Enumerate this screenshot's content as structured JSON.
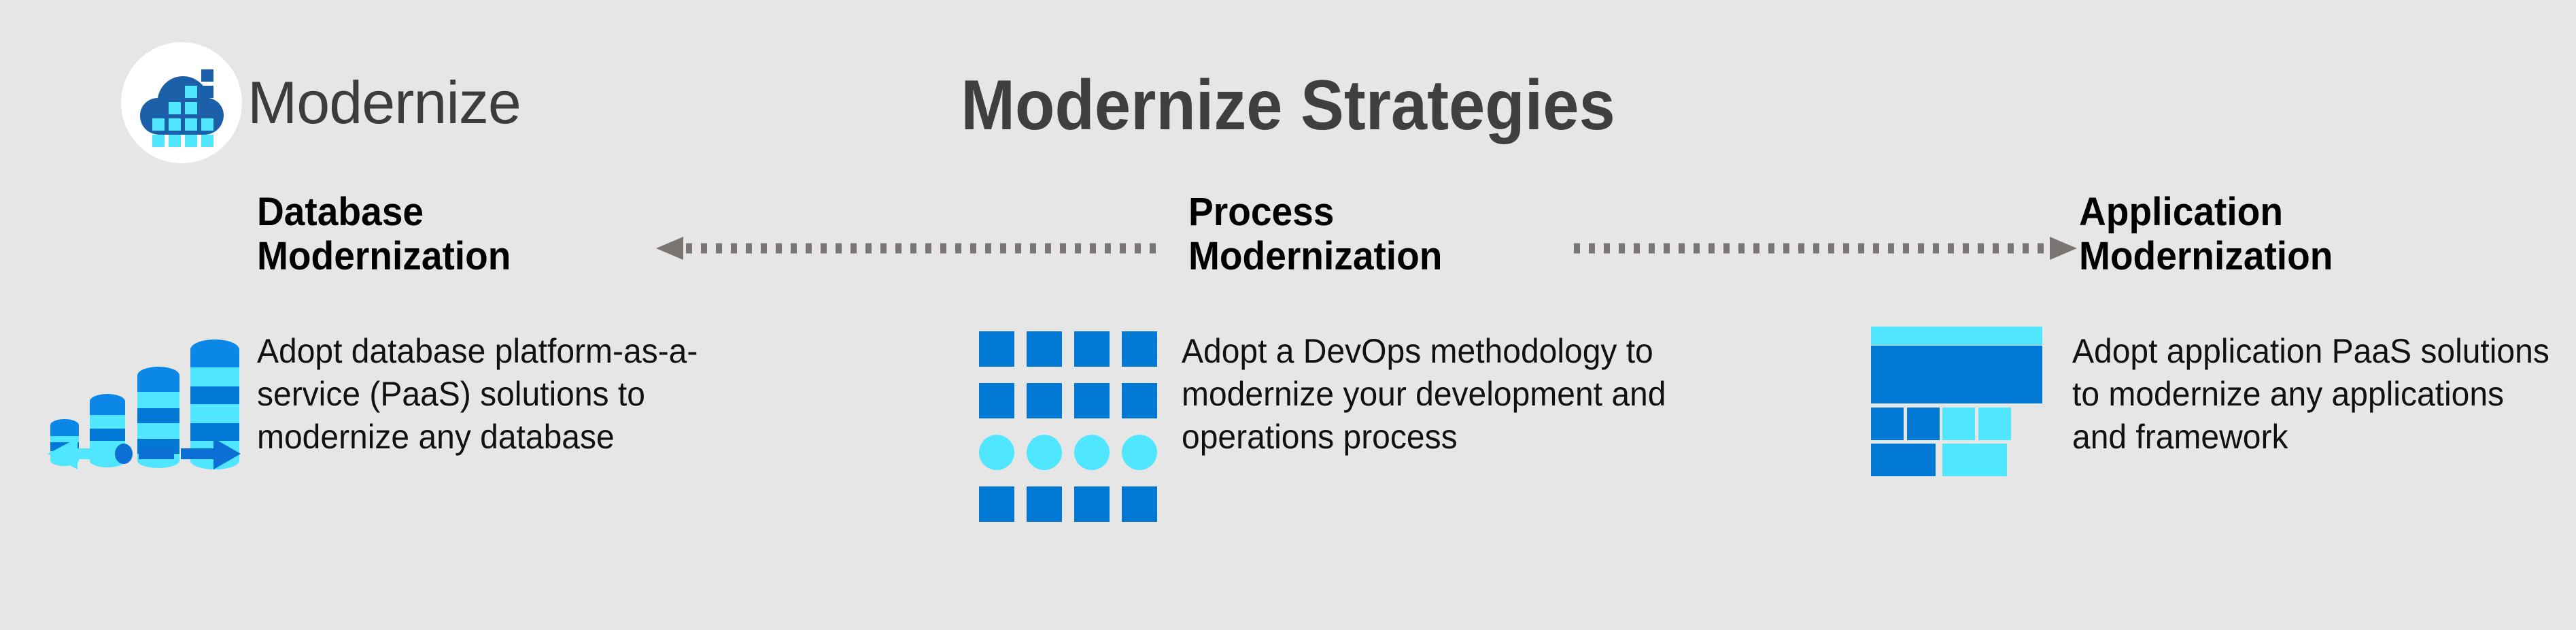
{
  "background_color": "#e6e6e6",
  "brand": {
    "name": "Modernize",
    "mark_icon": "cloud-with-data-blocks-icon",
    "mark_colors": {
      "circle": "#ffffff",
      "cloud": "#1b5fa8",
      "blocks_light": "#50e6ff",
      "blocks_dark": "#1b5fa8"
    }
  },
  "title": "Modernize Strategies",
  "title_color": "#3f3f3f",
  "colors": {
    "primary_blue": "#0078d4",
    "light_blue": "#50e6ff",
    "arrow_gray": "#7a7473",
    "heading_black": "#000000"
  },
  "connectors": [
    {
      "name": "process-to-database-arrow",
      "direction": "left",
      "style": "dotted",
      "color": "#7a7473"
    },
    {
      "name": "process-to-application-arrow",
      "direction": "right",
      "style": "dotted",
      "color": "#7a7473"
    }
  ],
  "columns": [
    {
      "id": "database",
      "heading": "Database\nModernization",
      "body": "Adopt database platform-as-a-service (PaaS) solutions to modernize any database",
      "icon": "database-cylinders-icon"
    },
    {
      "id": "process",
      "heading": "Process\nModernization",
      "body": "Adopt a DevOps methodology to modernize your development and operations process",
      "icon": "process-grid-icon"
    },
    {
      "id": "application",
      "heading": "Application\nModernization",
      "body": "Adopt application PaaS solutions to modernize any applications and framework",
      "icon": "application-wireframe-icon"
    }
  ]
}
